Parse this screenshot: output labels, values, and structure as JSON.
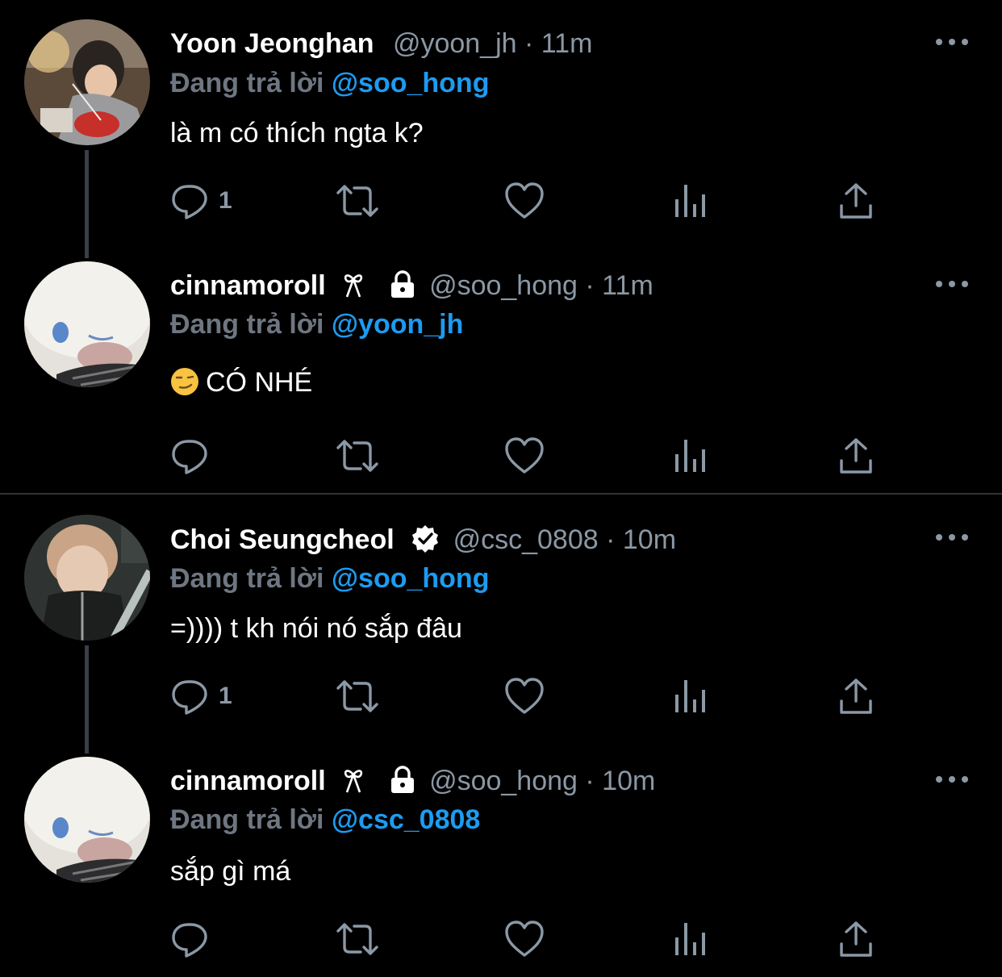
{
  "tweets": [
    {
      "name": "Yoon Jeonghan",
      "handle": "@yoon_jh",
      "time": "11m",
      "reply_prefix": "Đang trả lời",
      "reply_to": "@soo_hong",
      "text": "là m có thích ngta k?",
      "reply_count": "1"
    },
    {
      "name": "cinnamoroll",
      "handle": "@soo_hong",
      "time": "11m",
      "reply_prefix": "Đang trả lời",
      "reply_to": "@yoon_jh",
      "text": "CÓ NHÉ",
      "emoji": "smirk-emoji"
    },
    {
      "name": "Choi Seungcheol",
      "handle": "@csc_0808",
      "time": "10m",
      "reply_prefix": "Đang trả lời",
      "reply_to": "@soo_hong",
      "text": "=)))) t kh nói nó sắp đâu",
      "reply_count": "1"
    },
    {
      "name": "cinnamoroll",
      "handle": "@soo_hong",
      "time": "10m",
      "reply_prefix": "Đang trả lời",
      "reply_to": "@csc_0808",
      "text": "sắp gì má"
    }
  ],
  "separator": " · ",
  "colors": {
    "background": "#000000",
    "mention": "#1d9bf0",
    "muted": "#8b98a5",
    "divider": "#2f3336"
  },
  "icons": [
    "reply-icon",
    "retweet-icon",
    "like-icon",
    "analytics-icon",
    "share-icon",
    "more-icon",
    "ribbon-icon",
    "lock-icon",
    "verified-icon"
  ]
}
